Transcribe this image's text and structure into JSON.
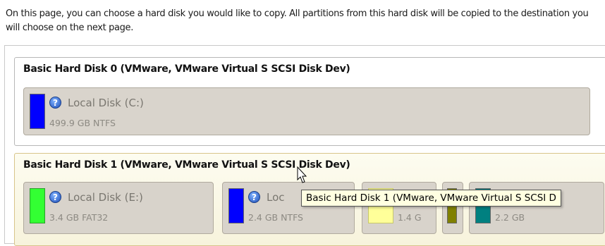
{
  "intro_text": "On this page, you can choose a hard disk you would like to copy. All partitions from this hard disk will be copied to the destination you will choose on the next page.",
  "disks": [
    {
      "title": "Basic Hard Disk 0 (VMware, VMware Virtual S SCSI Disk Dev)",
      "partitions": [
        {
          "name": "Local Disk (C:)",
          "size": "499.9 GB NTFS",
          "color": "#0000ff"
        }
      ]
    },
    {
      "title": "Basic Hard Disk 1 (VMware, VMware Virtual S SCSI Disk Dev)",
      "partitions": [
        {
          "name": "Local Disk (E:)",
          "size": "3.4 GB FAT32",
          "color": "#33ff33"
        },
        {
          "name": "Loc",
          "size": "2.4 GB NTFS",
          "color": "#0000ff"
        },
        {
          "name": "",
          "size": "1.4 G",
          "color": "#ffff99"
        },
        {
          "name": "",
          "size": "",
          "color": "#808000"
        },
        {
          "name": "",
          "size": "2.2 GB",
          "color": "#008080"
        }
      ]
    }
  ],
  "tooltip": "Basic Hard Disk 1 (VMware, VMware Virtual S SCSI D",
  "help_icon_glyph": "?"
}
